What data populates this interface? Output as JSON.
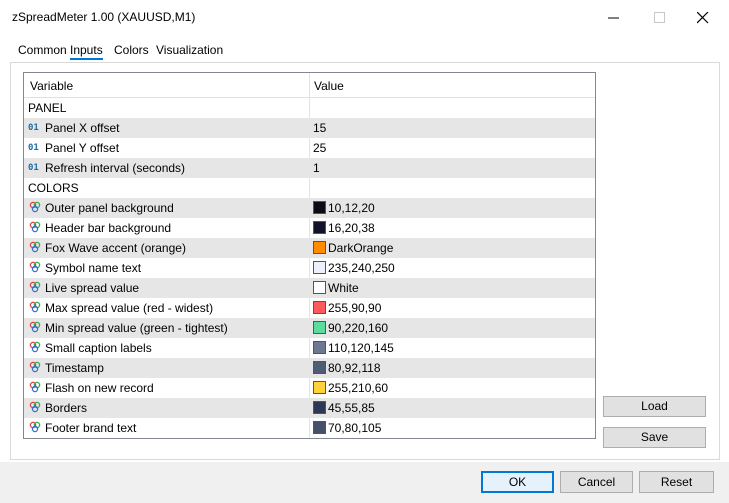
{
  "window": {
    "title": "zSpreadMeter 1.00 (XAUUSD,M1)"
  },
  "tabs": [
    {
      "label": "Common"
    },
    {
      "label": "Inputs"
    },
    {
      "label": "Colors"
    },
    {
      "label": "Visualization"
    }
  ],
  "active_tab": "Inputs",
  "grid": {
    "headers": {
      "variable": "Variable",
      "value": "Value"
    },
    "rows": [
      {
        "type": "section",
        "name": "PANEL",
        "value": ""
      },
      {
        "type": "int",
        "name": "Panel X offset",
        "value": "15"
      },
      {
        "type": "int",
        "name": "Panel Y offset",
        "value": "25"
      },
      {
        "type": "int",
        "name": "Refresh interval (seconds)",
        "value": "1"
      },
      {
        "type": "section",
        "name": "COLORS",
        "value": ""
      },
      {
        "type": "color",
        "name": "Outer panel background",
        "value": "10,12,20",
        "swatch": "#0a0c14"
      },
      {
        "type": "color",
        "name": "Header bar background",
        "value": "16,20,38",
        "swatch": "#101426"
      },
      {
        "type": "color",
        "name": "Fox Wave accent (orange)",
        "value": "DarkOrange",
        "swatch": "#ff8c00"
      },
      {
        "type": "color",
        "name": "Symbol name text",
        "value": "235,240,250",
        "swatch": "#ebf0fa"
      },
      {
        "type": "color",
        "name": "Live spread value",
        "value": "White",
        "swatch": "#ffffff"
      },
      {
        "type": "color",
        "name": "Max spread value (red - widest)",
        "value": "255,90,90",
        "swatch": "#ff5a5a"
      },
      {
        "type": "color",
        "name": "Min spread value (green - tightest)",
        "value": "90,220,160",
        "swatch": "#5adca0"
      },
      {
        "type": "color",
        "name": "Small caption labels",
        "value": "110,120,145",
        "swatch": "#6e7891"
      },
      {
        "type": "color",
        "name": "Timestamp",
        "value": "80,92,118",
        "swatch": "#505c76"
      },
      {
        "type": "color",
        "name": "Flash on new record",
        "value": "255,210,60",
        "swatch": "#ffd23c"
      },
      {
        "type": "color",
        "name": "Borders",
        "value": "45,55,85",
        "swatch": "#2d3755"
      },
      {
        "type": "color",
        "name": "Footer brand text",
        "value": "70,80,105",
        "swatch": "#465069"
      }
    ]
  },
  "side_buttons": {
    "load": "Load",
    "save": "Save"
  },
  "footer_buttons": {
    "ok": "OK",
    "cancel": "Cancel",
    "reset": "Reset"
  },
  "icons": {
    "int": "integer-type-icon",
    "color": "color-palette-icon"
  },
  "colors": {
    "accent": "#0078d7",
    "alt_row": "#e6e6e6"
  }
}
